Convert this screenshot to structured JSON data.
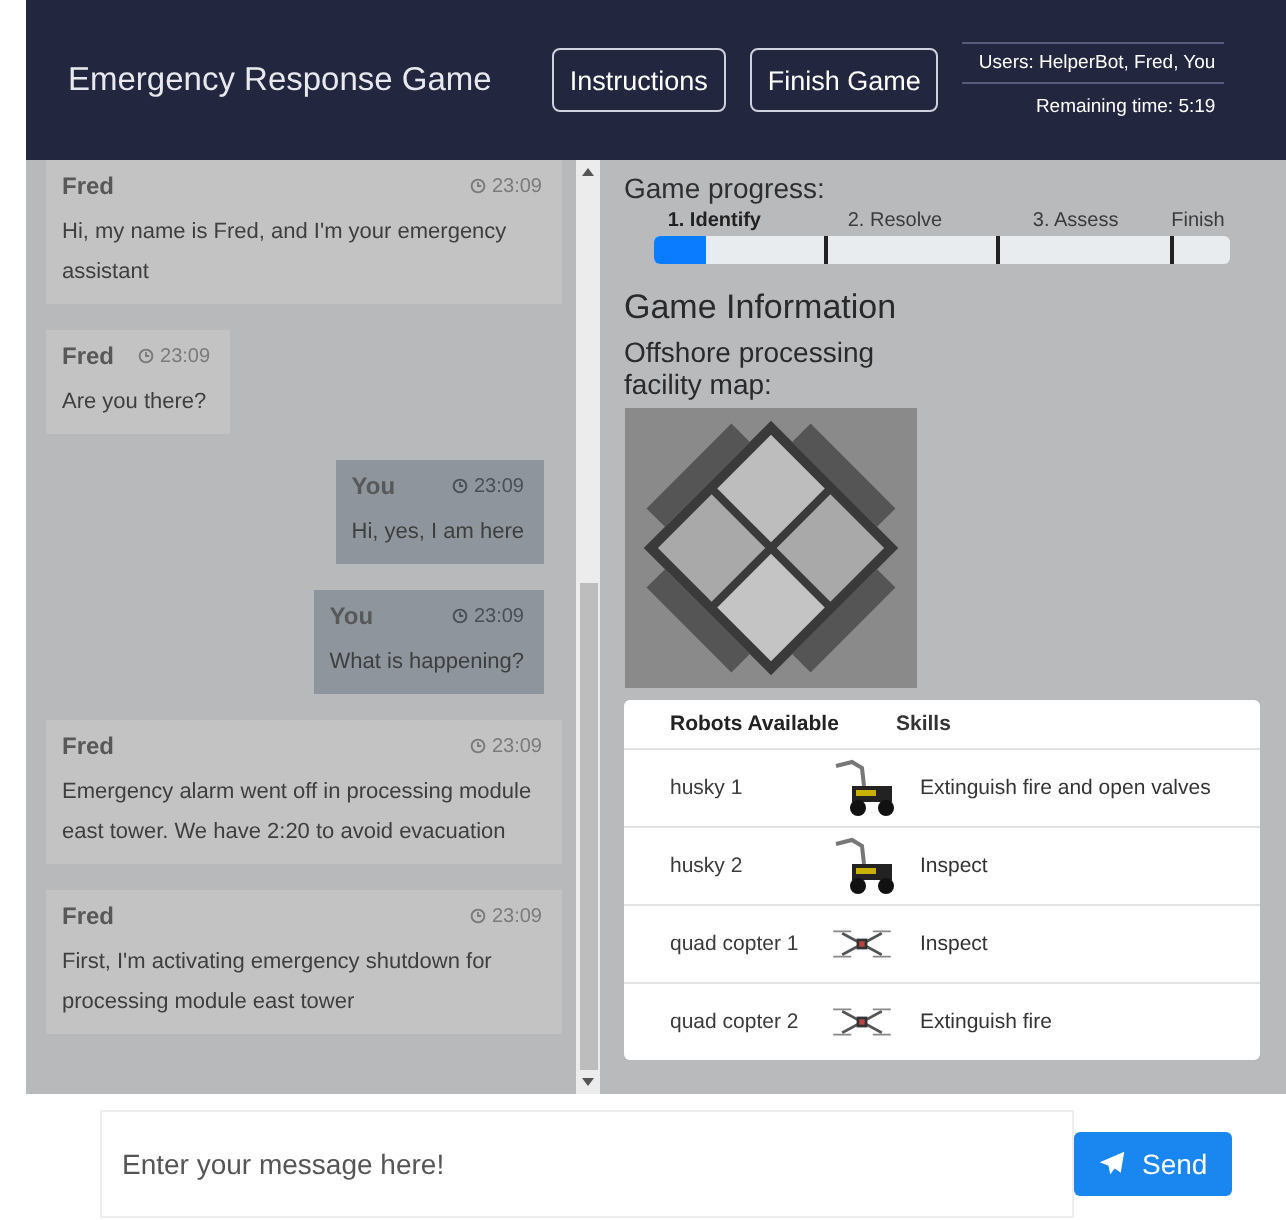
{
  "header": {
    "title": "Emergency Response Game",
    "buttons": [
      "Instructions",
      "Finish Game"
    ],
    "users": "Users: HelperBot, Fred, You",
    "remaining_time": "Remaining time: 5:19"
  },
  "chat": {
    "messages": [
      {
        "sender": "Fred",
        "time": "23:09",
        "text": "Hi, my name is Fred, and I'm your emergency assistant",
        "mine": false
      },
      {
        "sender": "Fred",
        "time": "23:09",
        "text": "Are you there?",
        "mine": false
      },
      {
        "sender": "You",
        "time": "23:09",
        "text": "Hi, yes, I am here",
        "mine": true
      },
      {
        "sender": "You",
        "time": "23:09",
        "text": "What is happening?",
        "mine": true
      },
      {
        "sender": "Fred",
        "time": "23:09",
        "text": "Emergency alarm went off in processing module east tower. We have 2:20 to avoid evacuation",
        "mine": false
      },
      {
        "sender": "Fred",
        "time": "23:09",
        "text": "First, I'm activating emergency shutdown for processing module east tower",
        "mine": false
      }
    ]
  },
  "progress": {
    "label": "Game progress:",
    "level": 0.09,
    "steps": [
      {
        "label": "1. Identify",
        "selected": true
      },
      {
        "label": "2. Resolve",
        "selected": false
      },
      {
        "label": "3. Assess",
        "selected": false
      },
      {
        "label": "Finish",
        "selected": false
      }
    ]
  },
  "info": {
    "heading": "Game Information",
    "map_caption": "Offshore processing facility map:"
  },
  "robots": {
    "columns": [
      "Robots Available",
      "Skills"
    ],
    "rows": [
      {
        "name": "husky 1",
        "kind": "ground",
        "skills": "Extinguish fire and open valves"
      },
      {
        "name": "husky 2",
        "kind": "ground",
        "skills": "Inspect"
      },
      {
        "name": "quad copter 1",
        "kind": "drone",
        "skills": "Inspect"
      },
      {
        "name": "quad copter 2",
        "kind": "drone",
        "skills": "Extinguish fire"
      }
    ]
  },
  "composer": {
    "placeholder": "Enter your message here!",
    "send": "Send"
  }
}
